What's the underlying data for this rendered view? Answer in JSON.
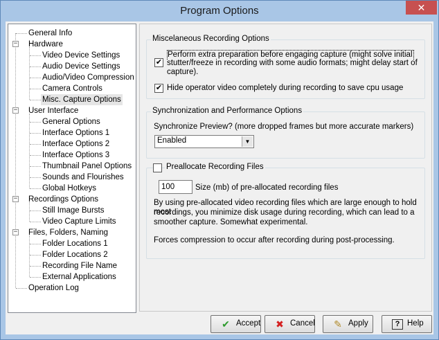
{
  "window": {
    "title": "Program Options",
    "close_glyph": "✕"
  },
  "tree": {
    "items": [
      {
        "label": "General Info"
      },
      {
        "label": "Hardware"
      },
      {
        "label": "Video Device Settings"
      },
      {
        "label": "Audio Device Settings"
      },
      {
        "label": "Audio/Video Compression"
      },
      {
        "label": "Camera Controls"
      },
      {
        "label": "Misc. Capture Options"
      },
      {
        "label": "User Interface"
      },
      {
        "label": "General Options"
      },
      {
        "label": "Interface Options 1"
      },
      {
        "label": "Interface Options 2"
      },
      {
        "label": "Interface Options 3"
      },
      {
        "label": "Thumbnail Panel Options"
      },
      {
        "label": "Sounds and Flourishes"
      },
      {
        "label": "Global Hotkeys"
      },
      {
        "label": "Recordings Options"
      },
      {
        "label": "Still Image Bursts"
      },
      {
        "label": "Video Capture Limits"
      },
      {
        "label": "Files, Folders, Naming"
      },
      {
        "label": "Folder Locations 1"
      },
      {
        "label": "Folder Locations 2"
      },
      {
        "label": "Recording File Name"
      },
      {
        "label": "External Applications"
      },
      {
        "label": "Operation Log"
      }
    ],
    "expander_glyph": "−"
  },
  "misc_group": {
    "title": "Miscelaneous Recording Options",
    "extra_prep": {
      "checked": "✔",
      "line1": "Perform extra preparation before engaging capture (might solve initial",
      "line2": "stutter/freeze in recording with some audio formats; might delay start of",
      "line3": "capture)."
    },
    "hide_video": {
      "checked": "✔",
      "label": "Hide operator video completely during recording to save cpu usage"
    }
  },
  "sync_group": {
    "title": "Synchronization and Performance Options",
    "question": "Synchronize Preview? (more dropped frames but more accurate markers)",
    "select_value": "Enabled",
    "select_arrow": "▼"
  },
  "prealloc_group": {
    "title": "Preallocate Recording Files",
    "checked": "",
    "size_value": "100",
    "size_label": "Size (mb) of pre-allocated recording files",
    "desc1": "By using pre-allocated video recording files which are large enough to hold most",
    "desc2": "recordings, you minimize disk usage during recording, which can lead to a",
    "desc3": "smoother capture.  Somewhat experimental.",
    "desc4": "Forces compression to occur after recording during post-processing."
  },
  "buttons": {
    "accept": {
      "label": "Accept",
      "glyph": "✔"
    },
    "cancel": {
      "label": "Cancel",
      "glyph": "✖"
    },
    "apply": {
      "label": "Apply",
      "glyph": "✎"
    },
    "help": {
      "label": "Help",
      "glyph": "?"
    }
  },
  "colors": {
    "accept_icon": "#2e9b2e",
    "cancel_icon": "#d42020",
    "apply_icon": "#b08a2a",
    "close_button": "#c75050"
  }
}
